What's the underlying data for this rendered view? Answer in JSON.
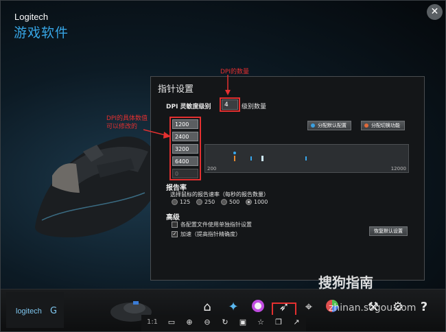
{
  "app": {
    "brand": "Logitech",
    "title": "游戏软件",
    "close": "✕"
  },
  "panel": {
    "title": "指针设置",
    "dpi_label": "DPI 灵敏度级别",
    "count_value": "4",
    "count_label": "级别数量",
    "dpi_levels": [
      "1200",
      "2400",
      "3200",
      "6400",
      "0"
    ],
    "btn_default": "分配默认配置",
    "btn_switch": "分配切换功能",
    "axis_min": "200",
    "axis_max": "12000",
    "report_title": "报告率",
    "report_desc": "选择鼠标的报告速率（每秒的报告数量）",
    "report_options": [
      "125",
      "250",
      "500",
      "1000"
    ],
    "report_selected": "1000",
    "advanced_title": "高级",
    "chk1": "各配置文件使用单独指针设置",
    "chk2": "加速（提高指针精确度）",
    "btn_restore": "恢复默认设置"
  },
  "annotations": {
    "count": "DPI的数量",
    "values_line1": "DPI的具体数值",
    "values_line2": "可以修改的"
  },
  "bottom": {
    "logo": "logitech",
    "zoom": "1:1",
    "watermark": "搜狗指南",
    "watermark_url": "zhinan.sogou.com"
  },
  "colors": {
    "accent": "#37a6e6",
    "annotation": "#e53030",
    "panel_bg": "#141618"
  }
}
